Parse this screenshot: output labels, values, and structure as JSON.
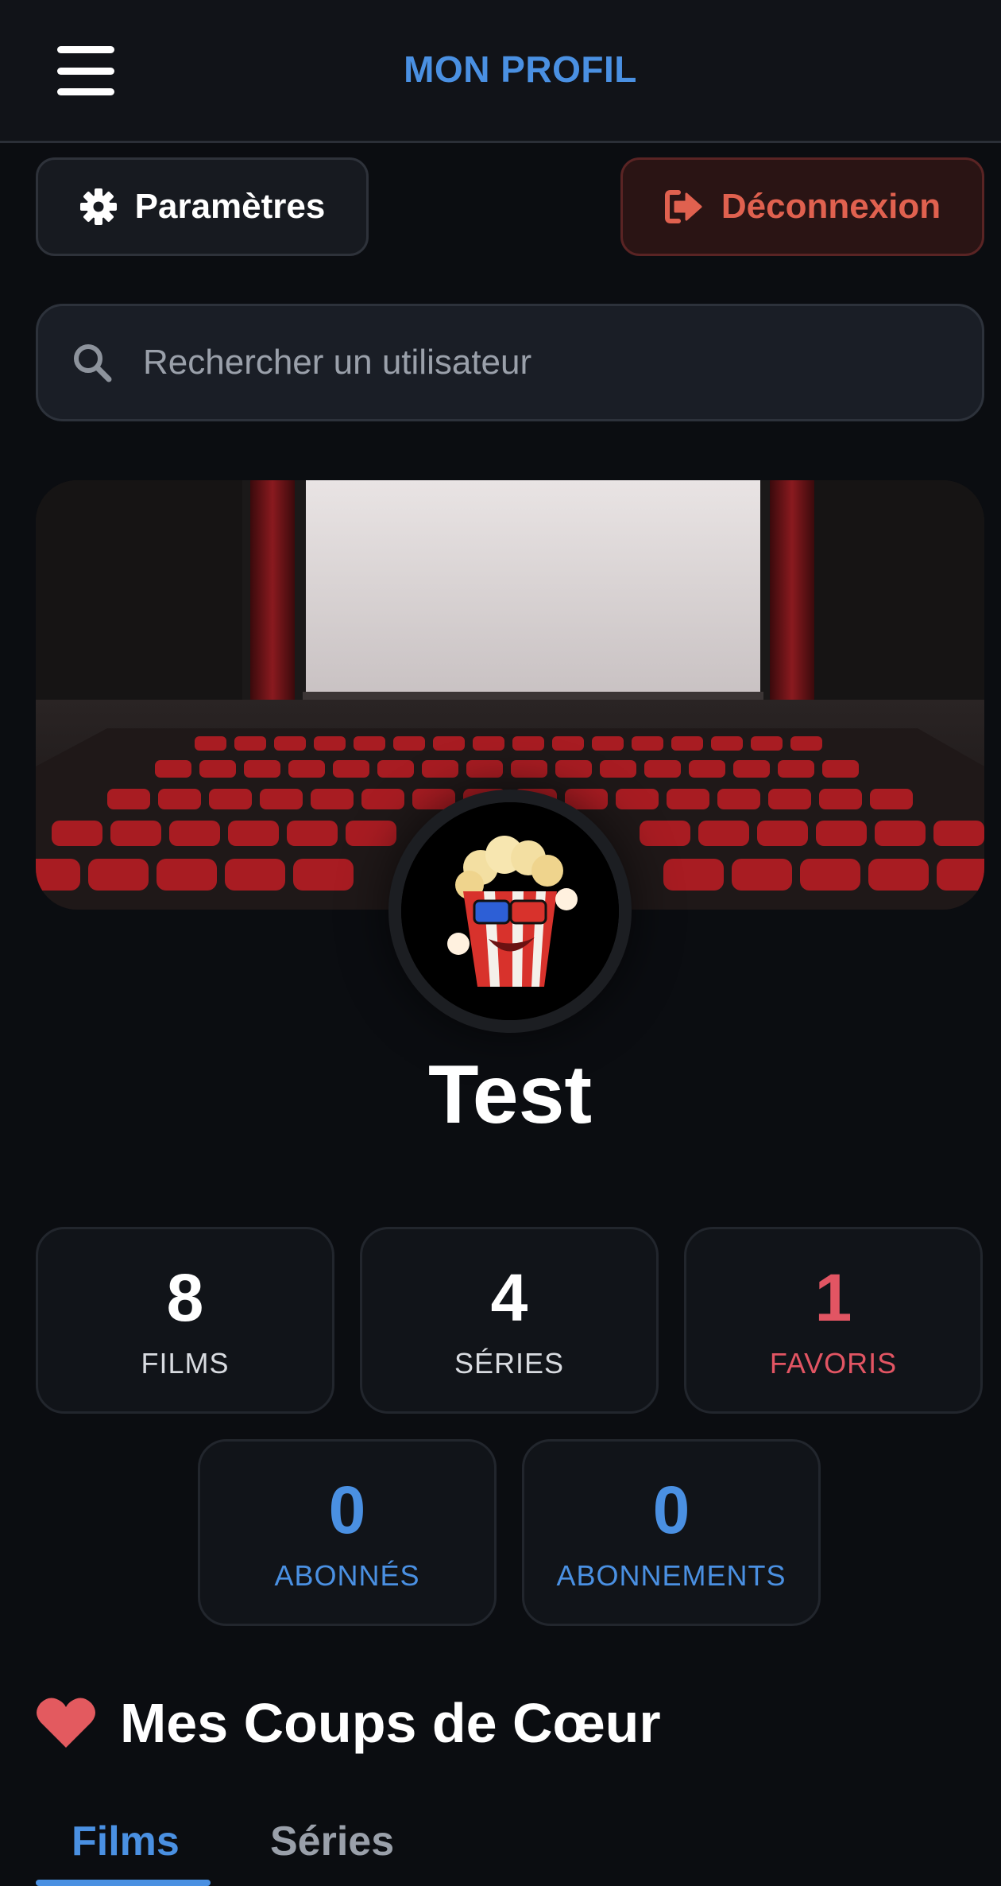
{
  "header": {
    "title": "MON PROFIL",
    "menu_icon": "hamburger-menu-icon"
  },
  "actions": {
    "settings_label": "Paramètres",
    "settings_icon": "gear-icon",
    "logout_label": "Déconnexion",
    "logout_icon": "sign-out-icon"
  },
  "search": {
    "placeholder": "Rechercher un utilisateur",
    "value": "",
    "icon": "search-icon"
  },
  "profile": {
    "banner_image": "cinema-theater-banner",
    "avatar_image": "popcorn-mascot-avatar",
    "username": "Test"
  },
  "stats": [
    {
      "value": "8",
      "label": "FILMS",
      "color": "#ffffff",
      "label_color": "#d8dbe0"
    },
    {
      "value": "4",
      "label": "SÉRIES",
      "color": "#ffffff",
      "label_color": "#d8dbe0"
    },
    {
      "value": "1",
      "label": "FAVORIS",
      "color": "#e25563",
      "label_color": "#e25563"
    },
    {
      "value": "0",
      "label": "ABONNÉS",
      "color": "#4a90e2",
      "label_color": "#4a90e2"
    },
    {
      "value": "0",
      "label": "ABONNEMENTS",
      "color": "#4a90e2",
      "label_color": "#4a90e2"
    }
  ],
  "favorites": {
    "title": "Mes Coups de Cœur",
    "icon": "heart-icon",
    "tabs": [
      {
        "label": "Films",
        "active": true
      },
      {
        "label": "Séries",
        "active": false
      }
    ]
  },
  "colors": {
    "accent": "#4a90e2",
    "danger": "#e0614f",
    "favorite": "#e25563",
    "background": "#0b0d11"
  }
}
